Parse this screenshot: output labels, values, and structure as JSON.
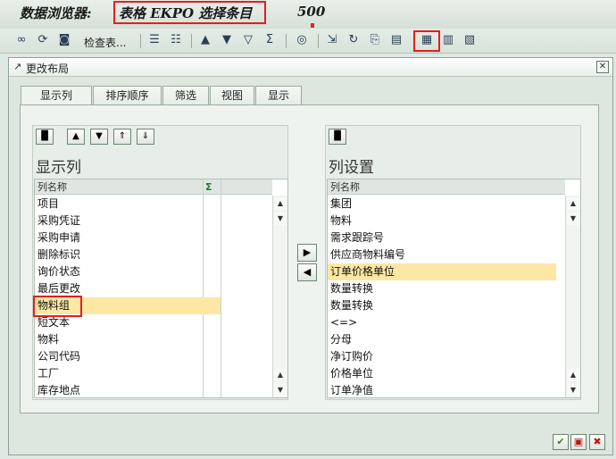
{
  "header": {
    "title_prefix": "数据浏览器:",
    "title_table": "表格 EKPO 选择条目",
    "hit_count": "500"
  },
  "toolbar": {
    "check_label": "检查表..."
  },
  "dialog": {
    "title": "更改布局",
    "tabs": [
      {
        "label": "显示列",
        "active": true
      },
      {
        "label": "排序顺序",
        "active": false
      },
      {
        "label": "筛选",
        "active": false
      },
      {
        "label": "视图",
        "active": false
      },
      {
        "label": "显示",
        "active": false
      }
    ],
    "left": {
      "heading": "显示列",
      "column_header": "列名称",
      "sum_symbol": "Σ",
      "items": [
        "项目",
        "采购凭证",
        "采购申请",
        "删除标识",
        "询价状态",
        "最后更改",
        "物料组",
        "短文本",
        "物料",
        "公司代码",
        "工厂",
        "库存地点"
      ],
      "selected_index": 6
    },
    "right": {
      "heading": "列设置",
      "column_header": "列名称",
      "items": [
        "集团",
        "物料",
        "需求跟踪号",
        "供应商物料编号",
        "订单价格单位",
        "数量转换",
        "数量转换",
        "<=>",
        "分母",
        "净订购价",
        "价格单位",
        "订单净值"
      ],
      "selected_index": 4
    }
  },
  "colors": {
    "highlight_box": "#e02020",
    "selected_row": "#fde7a4",
    "background": "#dfe8e2"
  }
}
